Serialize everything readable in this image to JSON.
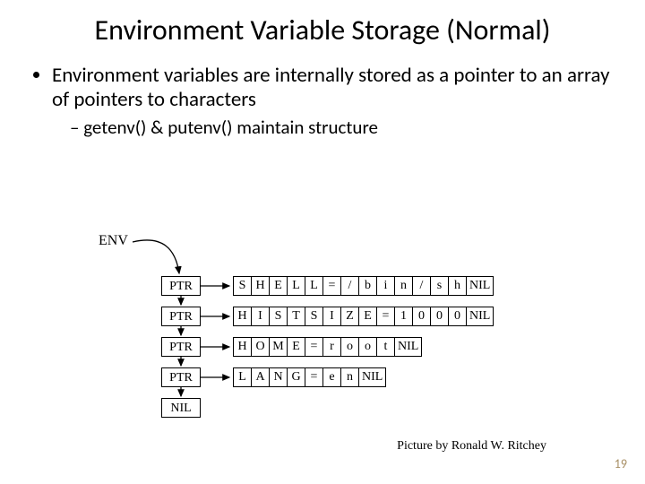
{
  "title": "Environment Variable Storage (Normal)",
  "bullet1": "Environment variables are internally stored as a pointer to an array of pointers to characters",
  "bullet2": "getenv() & putenv() maintain structure",
  "env_label": "ENV",
  "ptr_label": "PTR",
  "nil_label": "NIL",
  "rows": [
    [
      "S",
      "H",
      "E",
      "L",
      "L",
      "=",
      "/",
      "b",
      "i",
      "n",
      "/",
      "s",
      "h",
      "NIL"
    ],
    [
      "H",
      "I",
      "S",
      "T",
      "S",
      "I",
      "Z",
      "E",
      "=",
      "1",
      "0",
      "0",
      "0",
      "NIL"
    ],
    [
      "H",
      "O",
      "M",
      "E",
      "=",
      "r",
      "o",
      "o",
      "t",
      "NIL"
    ],
    [
      "L",
      "A",
      "N",
      "G",
      "=",
      "e",
      "n",
      "NIL"
    ]
  ],
  "credit": "Picture by Ronald W. Ritchey",
  "page": "19"
}
